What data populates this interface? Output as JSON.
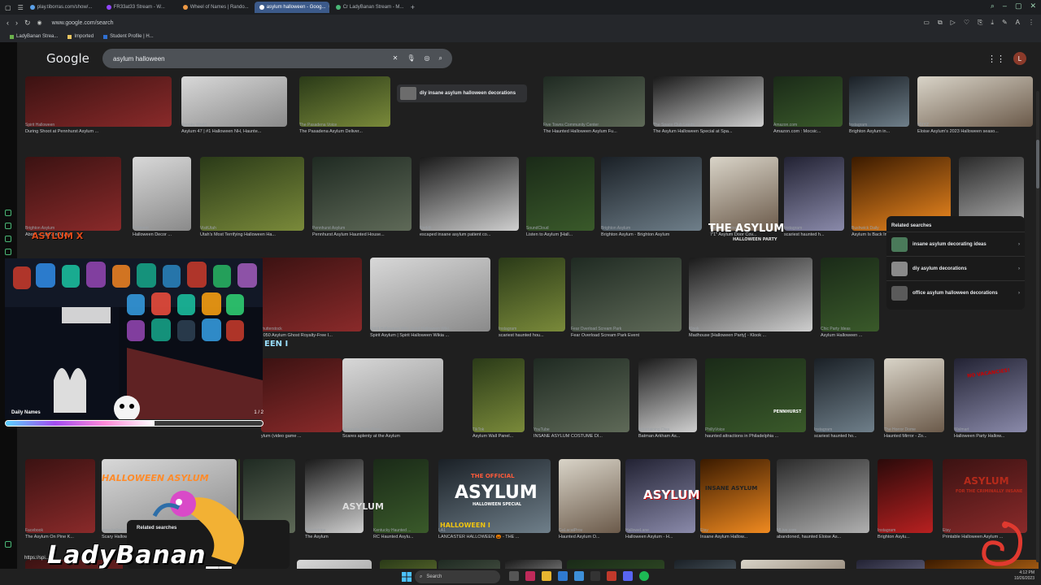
{
  "browser": {
    "tabs": [
      {
        "label": "play.tiborras.com/show/..."
      },
      {
        "label": "FR33at33 Stream - W..."
      },
      {
        "label": "Wheel of Names | Rando..."
      },
      {
        "label": "asylum halloween - Goog..."
      },
      {
        "label": "Cr LadyBanan Stream - M..."
      }
    ],
    "new_tab": "+",
    "url": "www.google.com/search",
    "bookmarks": [
      "LadyBanan Strea...",
      "Imported",
      "Student Profile | H..."
    ]
  },
  "google": {
    "logo": "Google",
    "query": "asylum halloween",
    "account_initial": "L",
    "suggestion": "diy insane asylum halloween decorations",
    "row0": [
      {
        "src": "Spirit Halloween",
        "cap": "During Shoot at Pennhurst Asylum ..."
      },
      {
        "src": "Spooky World",
        "cap": "Asylum 47 | #1 Halloween NH, Haunte..."
      },
      {
        "src": "The Pasadena Voice",
        "cap": "The Pasadena Asylum Deliver..."
      },
      {
        "src": "Five Towns Community Center",
        "cap": "The Haunted Halloween Asylum Fu..."
      },
      {
        "src": "The Space Club Leeds",
        "cap": "The Asylum Halloween Special at Spa..."
      },
      {
        "src": "Amazon.com",
        "cap": "Amazon.com : Mocsic..."
      },
      {
        "src": "Instagram",
        "cap": "Brighton Asylum in..."
      },
      {
        "src": "MXYZ",
        "cap": "Eloise Asylum's 2023 Halloween seaso..."
      }
    ],
    "row1": [
      {
        "src": "Brighton Asylum",
        "cap": "About - Brighton Asylum"
      },
      {
        "src": "Pinterest",
        "cap": "Halloween Decor ..."
      },
      {
        "src": "VisitUtah",
        "cap": "Utah's Most Terrifying Halloween Ha..."
      },
      {
        "src": "Pennhurst Asylum",
        "cap": "Pennhurst Asylum Haunted House..."
      },
      {
        "src": "Reddit",
        "cap": "escaped insane asylum patient co..."
      },
      {
        "src": "SoundCloud",
        "cap": "Listen to Asylum [Hall..."
      },
      {
        "src": "Brighton Asylum",
        "cap": "Brighton Asylum - Brighton Asylum"
      },
      {
        "src": "Target · In stock",
        "cap": "7'1\" Asylum Door Cov..."
      },
      {
        "src": "Instagram",
        "cap": "scariest haunted h..."
      },
      {
        "src": "Bushwick Daily",
        "cap": "Asylum Is Back In Ridgewood"
      },
      {
        "src": "Facebook",
        "cap": "Oklahoma Asylum Ha..."
      }
    ],
    "row2": [
      {
        "src": "Shutterstock",
        "cap": "1,050 Asylum Ghost Royalty-Free I..."
      },
      {
        "src": "Spirit Halloween Wiki: Spirit Halloween Wiki...",
        "cap": "Spirit Asylum | Spirit Halloween Wikia ..."
      },
      {
        "src": "Instagram",
        "cap": "scariest haunted hou..."
      },
      {
        "src": "Fear Overload Scream Park",
        "cap": "Fear Overload Scream Park Event"
      },
      {
        "src": "Klook",
        "cap": "Madhouse [Halloween Party] - Klook ..."
      },
      {
        "src": "Chic Party Ideas",
        "cap": "Asylum Halloween ..."
      }
    ],
    "row2_text": {
      "theasylum": "THE ASYLUM",
      "theasylum_sub": "HALLOWEEN PARTY",
      "asylumx": "ASYLUM X",
      "asylumx_sub": "HAUNTED HOUSE"
    },
    "row3": [
      {
        "src": "",
        "cap": "ylum (video game ..."
      },
      {
        "src": "Victorville Daily Press",
        "cap": "Scares aplenty at the Asylum"
      },
      {
        "src": "TikTok",
        "cap": "Asylum Wall Panel..."
      },
      {
        "src": "YouTube",
        "cap": "INSANE ASYLUM COSTUME DI..."
      },
      {
        "src": "Entertaining Diva",
        "cap": "Batman Arkham As..."
      },
      {
        "src": "PhillyVoice",
        "cap": "haunted attractions in Philadelphia ..."
      },
      {
        "src": "Instagram",
        "cap": "scariest haunted ho..."
      },
      {
        "src": "The Horror Dome",
        "cap": "Haunted Mirror - Zo..."
      },
      {
        "src": "Walmart",
        "cap": "Halloween Party Hallow..."
      }
    ],
    "row3_text": {
      "een": "EEN I",
      "novacancy": "NO VACANCIES!",
      "pennhurst": "PENNHURST"
    },
    "row4": [
      {
        "src": "Facebook",
        "cap": "The Asylum On Pine K..."
      },
      {
        "src": "www.halloweenasylum.com",
        "cap": "Scary Halloween Props..."
      },
      {
        "src": "",
        "cap": "Masks"
      },
      {
        "src": "TikTok",
        "cap": "The Asylum. #allo..."
      },
      {
        "src": "Ticketstripe",
        "cap": "The Asylum"
      },
      {
        "src": "Kentucky Haunted ...",
        "cap": "RC Haunted Asylu..."
      },
      {
        "src": "LA1",
        "cap": "LANCASTER HALLOWEEN 🎃 - THE ..."
      },
      {
        "src": "GaLacatProv",
        "cap": "Haunted Asylum O..."
      },
      {
        "src": "HalloweLane",
        "cap": "Halloween Asylum - H..."
      },
      {
        "src": "Etsy",
        "cap": "Insane Asylum Hallow..."
      },
      {
        "src": "MLive.com",
        "cap": "abandoned, haunted Eloise As..."
      },
      {
        "src": "Instagram",
        "cap": "Brighton Asylu..."
      },
      {
        "src": "Etsy",
        "cap": "Printable Halloween Asylum ..."
      }
    ],
    "row4_text": {
      "halloween_asylum": "HALLOWEEN ASYLUM",
      "asylum_big": "ASYLUM",
      "official": "THE OFFICIAL",
      "halloween_special": "HALLOWEEN SPECIAL",
      "halloween_small": "HALLOWEEN",
      "asylum_red": "ASYLUM",
      "party": "HALLOWEEN PARTY SIGN",
      "insane": "INSANE ASYLUM",
      "criminally": "ASYLUM",
      "criminally_sub": "FOR THE CRIMINALLY INSANE",
      "asylum_fog": "ASYLUM"
    },
    "row5_text": {
      "halloween": "HALLOWEEN I"
    },
    "related": {
      "title": "Related searches",
      "items": [
        "insane asylum decorating ideas",
        "diy asylum decorations",
        "office asylum halloween decorations"
      ]
    },
    "related2_title": "Related searches"
  },
  "overlay": {
    "daily_names_label": "Daily Names",
    "daily_names_count": "1 / 2",
    "daily_names_progress": 0.58,
    "streamer_name": "LadyBanan__",
    "stream_url_text": "https://spi..."
  },
  "taskbar": {
    "search_label": "Search",
    "tray_time": "4:12 PM",
    "tray_date": "10/26/2023"
  },
  "colors": {
    "google_bg": "#1f1f1f",
    "tab_active": "#3c5a8a",
    "accent_green": "#4ab776"
  }
}
